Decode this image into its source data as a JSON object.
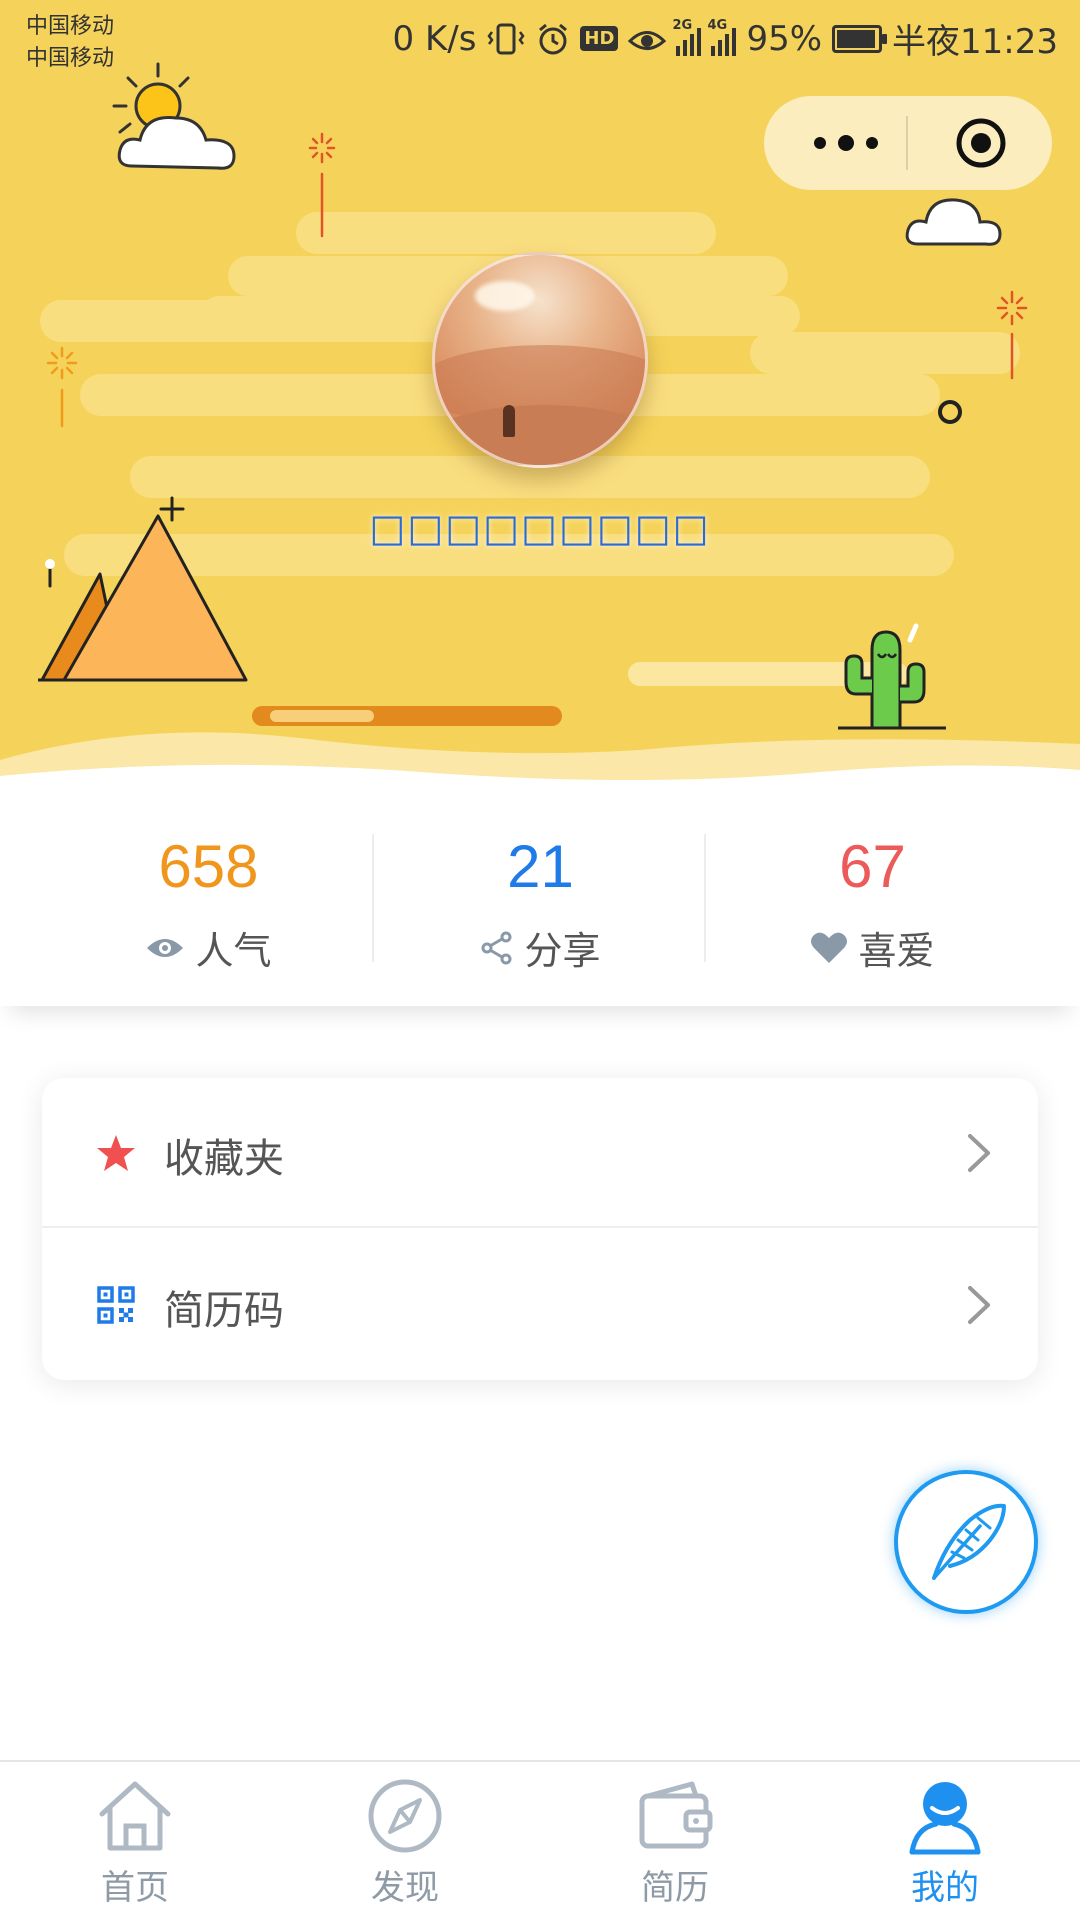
{
  "status_bar": {
    "carrier_1": "中国移动",
    "carrier_2": "中国移动",
    "net_speed": "0 K/s",
    "hd": "HD",
    "signal_1": "2G",
    "signal_2": "4G",
    "battery": "95%",
    "time": "半夜11:23"
  },
  "profile": {
    "user_name": "□□□□□□□□□",
    "progress": 0.38
  },
  "stats": [
    {
      "value": "658",
      "label": "人气",
      "icon": "eye-icon",
      "color": "#F0961C"
    },
    {
      "value": "21",
      "label": "分享",
      "icon": "share-icon",
      "color": "#1E7BE8"
    },
    {
      "value": "67",
      "label": "喜爱",
      "icon": "heart-icon",
      "color": "#EC5A5A"
    }
  ],
  "menu": [
    {
      "label": "收藏夹",
      "icon": "star-icon",
      "color": "#F05050"
    },
    {
      "label": "简历码",
      "icon": "qr-code-icon",
      "color": "#1E7BE8"
    }
  ],
  "tabs": [
    {
      "label": "首页",
      "icon": "home-icon",
      "active": false
    },
    {
      "label": "发现",
      "icon": "compass-icon",
      "active": false
    },
    {
      "label": "简历",
      "icon": "wallet-icon",
      "active": false
    },
    {
      "label": "我的",
      "icon": "user-icon",
      "active": true
    }
  ],
  "colors": {
    "header_bg": "#F5D35A",
    "accent": "#1E90F0",
    "tab_inactive": "#8E9AA6"
  }
}
